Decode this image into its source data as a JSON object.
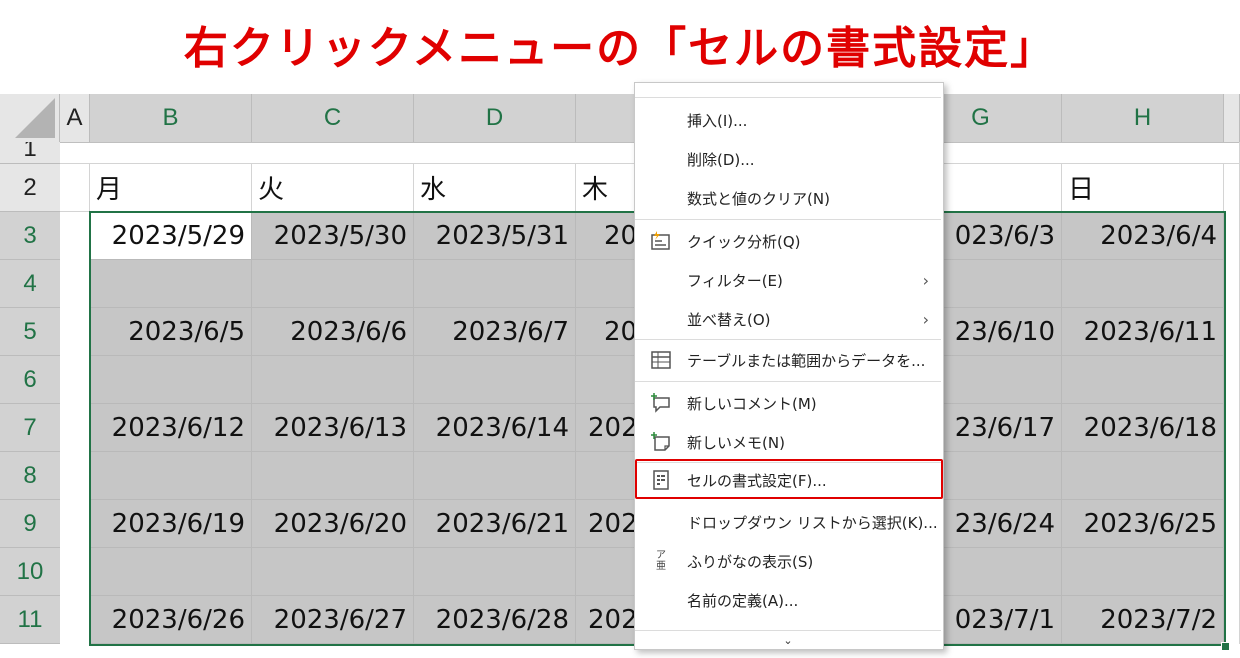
{
  "banner": {
    "title": "右クリックメニューの「セルの書式設定」"
  },
  "sheet": {
    "columns": [
      "A",
      "B",
      "C",
      "D",
      "",
      "",
      "G",
      "H"
    ],
    "rows": [
      "1",
      "2",
      "3",
      "4",
      "5",
      "6",
      "7",
      "8",
      "9",
      "10",
      "11"
    ],
    "day_headers": {
      "B": "月",
      "C": "火",
      "D": "水",
      "E": "木",
      "H": "日"
    },
    "dates": {
      "r3": {
        "B": "2023/5/29",
        "C": "2023/5/30",
        "D": "2023/5/31",
        "E": "20",
        "G": "023/6/3",
        "H": "2023/6/4"
      },
      "r5": {
        "B": "2023/6/5",
        "C": "2023/6/6",
        "D": "2023/6/7",
        "E": "20",
        "G": "23/6/10",
        "H": "2023/6/11"
      },
      "r7": {
        "B": "2023/6/12",
        "C": "2023/6/13",
        "D": "2023/6/14",
        "E": "202",
        "G": "23/6/17",
        "H": "2023/6/18"
      },
      "r9": {
        "B": "2023/6/19",
        "C": "2023/6/20",
        "D": "2023/6/21",
        "E": "202",
        "G": "23/6/24",
        "H": "2023/6/25"
      },
      "r11": {
        "B": "2023/6/26",
        "C": "2023/6/27",
        "D": "2023/6/28",
        "E": "202",
        "G": "023/7/1",
        "H": "2023/7/2"
      }
    },
    "colors": {
      "header_text": "#217346",
      "selection": "#c6c6c6",
      "selection_border": "#217346"
    }
  },
  "menu": {
    "items": [
      {
        "label": "挿入(I)...",
        "icon": ""
      },
      {
        "label": "削除(D)...",
        "icon": ""
      },
      {
        "label": "数式と値のクリア(N)",
        "icon": ""
      },
      {
        "label": "クイック分析(Q)",
        "icon": "quick-analysis-icon"
      },
      {
        "label": "フィルター(E)",
        "icon": "",
        "submenu": true
      },
      {
        "label": "並べ替え(O)",
        "icon": "",
        "submenu": true
      },
      {
        "label": "テーブルまたは範囲からデータを...",
        "icon": "table-icon"
      },
      {
        "label": "新しいコメント(M)",
        "icon": "comment-icon"
      },
      {
        "label": "新しいメモ(N)",
        "icon": "note-icon"
      },
      {
        "label": "セルの書式設定(F)...",
        "icon": "format-cells-icon",
        "highlighted": true
      },
      {
        "label": "ドロップダウン リストから選択(K)...",
        "icon": ""
      },
      {
        "label": "ふりがなの表示(S)",
        "icon": "furigana-icon"
      },
      {
        "label": "名前の定義(A)...",
        "icon": ""
      }
    ],
    "submenu_arrow": "›",
    "more_chevron": "⌄",
    "furigana_glyph_top": "ア",
    "furigana_glyph_bottom": "亜",
    "highlight_color": "#e00000"
  }
}
